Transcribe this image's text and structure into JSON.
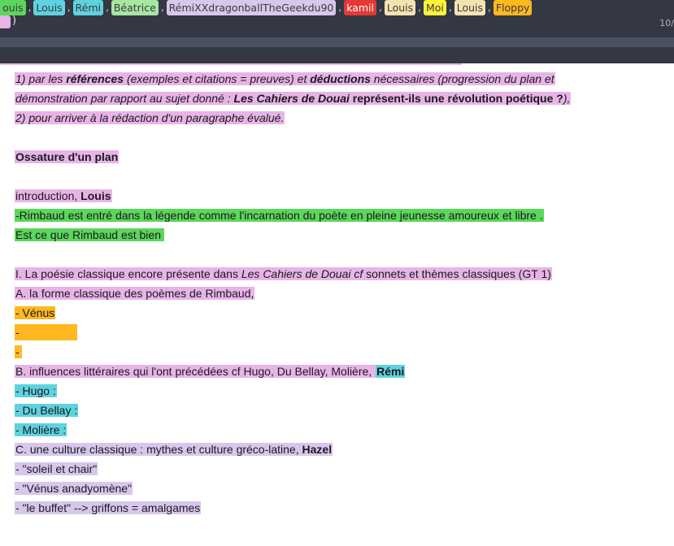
{
  "authors_bar": {
    "chips": [
      {
        "label": "ouis",
        "color": "#5cd65c"
      },
      {
        "label": "Louis",
        "color": "#5fd2e0"
      },
      {
        "label": "Rémi",
        "color": "#5fd2e0"
      },
      {
        "label": "Béatrice",
        "color": "#a8e6a3"
      },
      {
        "label": "RémiXXdragonballTheGeekdu90",
        "color": "#d8c7ec"
      },
      {
        "label": "kamil",
        "color": "#e53935"
      },
      {
        "label": "Louis",
        "color": "#f4e3b1"
      },
      {
        "label": "Moi",
        "color": "#fff23a"
      },
      {
        "label": "Louis",
        "color": "#f4e3b1"
      },
      {
        "label": "Floppy",
        "color": "#ffb81f"
      }
    ],
    "separator": ",",
    "closing_paren": ")",
    "page_indicator": "10/"
  },
  "document": {
    "line1": {
      "prefix": "1) par les ",
      "bold1": "références",
      "mid1": " (exemples et citations = preuves) et ",
      "bold2": "déductions",
      "suffix": " nécessaires (progression du plan et"
    },
    "line2": {
      "prefix": "démonstration par rapport au sujet donné : ",
      "title": "Les Cahiers de Douai",
      "bold": " représent-ils une révolution poétique ?",
      "suffix": "),"
    },
    "line3": "2) pour arriver à la rédaction d'un paragraphe évalué.",
    "ossature": "Ossature d'un plan",
    "intro": {
      "text": "introduction, ",
      "author": "Louis"
    },
    "rimbaud_line": "-Rimbaud est entré dans la légende comme l'incarnation du poète en pleine jeunesse amoureux et libre .",
    "est_ce": "Est ce que Rimbaud est bien",
    "part1": {
      "prefix": "I. La poésie classique encore présente dans ",
      "title": "Les Cahiers de Douai cf",
      "suffix": " sonnets et thèmes classiques (GT 1)"
    },
    "partA": "A. la forme classique des poèmes de Rimbaud,",
    "venus": "- Vénus",
    "dash1": "-",
    "dash2": "-",
    "partB": {
      "text": "B. influences littéraires qui l'ont précédées cf Hugo, Du Bellay, Molière, ",
      "author": "Rémi"
    },
    "hugo": "- Hugo :",
    "dubellay": "- Du Bellay :",
    "moliere": "- Molière :",
    "partC": {
      "text": "C. une culture classique : mythes et culture gréco-latine, ",
      "author": "Hazel"
    },
    "soleil": "- \"soleil et chair\"",
    "venus_ana": "- \"Vénus anadyomène\"",
    "buffet": "- \"le buffet\" --> griffons = amalgames"
  }
}
